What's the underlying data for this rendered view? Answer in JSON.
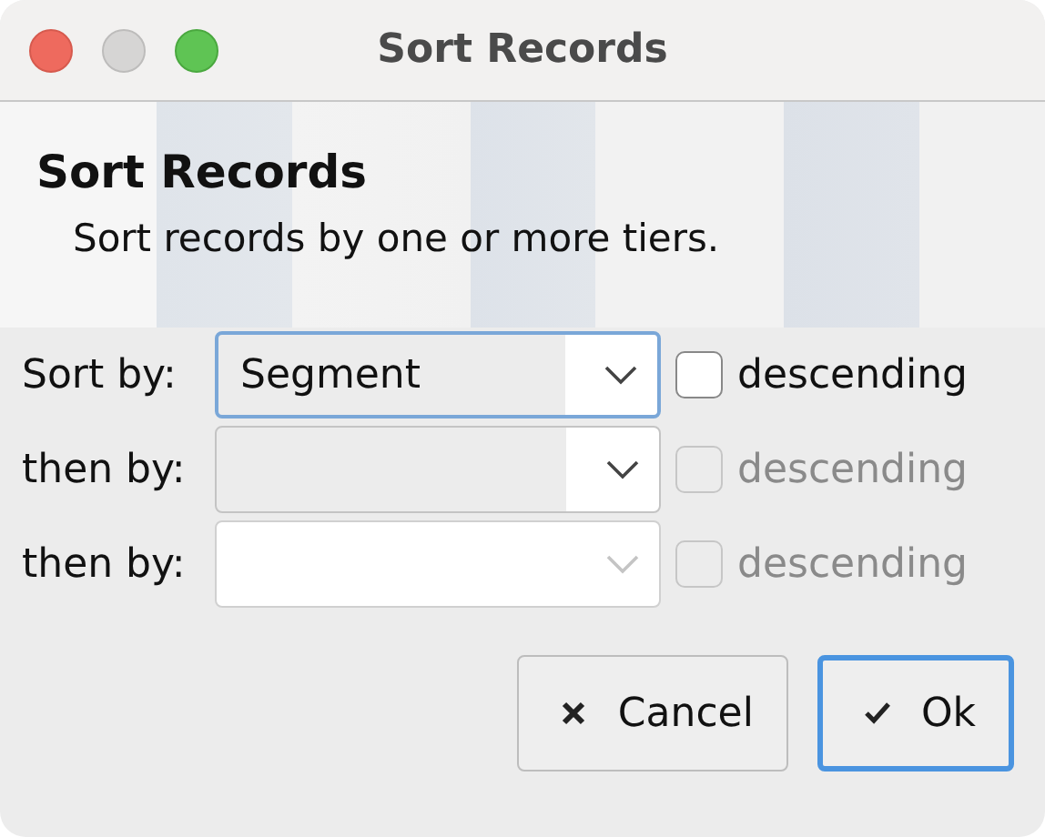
{
  "window": {
    "title": "Sort Records"
  },
  "header": {
    "title": "Sort Records",
    "subtitle": "Sort records by one or more tiers."
  },
  "tiers": [
    {
      "label": "Sort by:",
      "value": "Segment",
      "focused": true,
      "disabled": false,
      "descending": {
        "label": "descending",
        "checked": false,
        "disabled": false
      }
    },
    {
      "label": "then by:",
      "focused": false,
      "disabled": false,
      "descending": {
        "label": "descending",
        "checked": false,
        "disabled": true
      }
    },
    {
      "label": "then by:",
      "focused": false,
      "disabled": true,
      "descending": {
        "label": "descending",
        "checked": false,
        "disabled": true
      }
    }
  ],
  "buttons": [
    {
      "kind": "cancel",
      "label": "Cancel",
      "default": false
    },
    {
      "kind": "ok",
      "label": "Ok",
      "default": true
    }
  ]
}
